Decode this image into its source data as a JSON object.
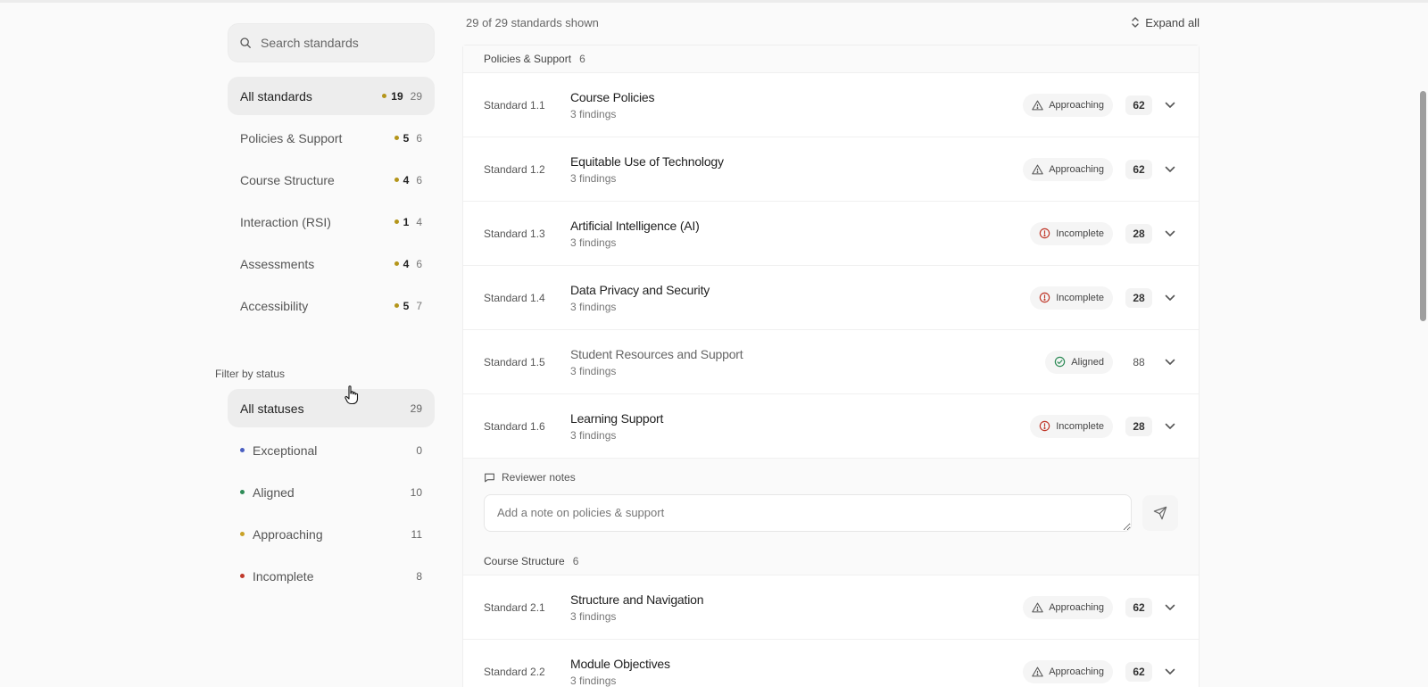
{
  "search": {
    "placeholder": "Search standards"
  },
  "categories": [
    {
      "label": "All standards",
      "count_a": "19",
      "count_b": "29",
      "active": true
    },
    {
      "label": "Policies & Support",
      "count_a": "5",
      "count_b": "6"
    },
    {
      "label": "Course Structure",
      "count_a": "4",
      "count_b": "6"
    },
    {
      "label": "Interaction (RSI)",
      "count_a": "1",
      "count_b": "4"
    },
    {
      "label": "Assessments",
      "count_a": "4",
      "count_b": "6"
    },
    {
      "label": "Accessibility",
      "count_a": "5",
      "count_b": "7"
    }
  ],
  "filter": {
    "title": "Filter by status",
    "statuses": [
      {
        "label": "All statuses",
        "count": "29",
        "active": true
      },
      {
        "label": "Exceptional",
        "count": "0",
        "color": "#4a5fc1"
      },
      {
        "label": "Aligned",
        "count": "10",
        "color": "#2e8b57"
      },
      {
        "label": "Approaching",
        "count": "11",
        "color": "#c9a227"
      },
      {
        "label": "Incomplete",
        "count": "8",
        "color": "#c0392b"
      }
    ]
  },
  "main": {
    "shown_text": "29 of 29 standards shown",
    "expand_label": "Expand all",
    "groups": [
      {
        "name": "Policies & Support",
        "count": "6",
        "rows": [
          {
            "code": "Standard 1.1",
            "title": "Course Policies",
            "findings": "3 findings",
            "status": "Approaching",
            "score": "62"
          },
          {
            "code": "Standard 1.2",
            "title": "Equitable Use of Technology",
            "findings": "3 findings",
            "status": "Approaching",
            "score": "62"
          },
          {
            "code": "Standard 1.3",
            "title": "Artificial Intelligence (AI)",
            "findings": "3 findings",
            "status": "Incomplete",
            "score": "28"
          },
          {
            "code": "Standard 1.4",
            "title": "Data Privacy and Security",
            "findings": "3 findings",
            "status": "Incomplete",
            "score": "28"
          },
          {
            "code": "Standard 1.5",
            "title": "Student Resources and Support",
            "findings": "3 findings",
            "status": "Aligned",
            "score": "88"
          },
          {
            "code": "Standard 1.6",
            "title": "Learning Support",
            "findings": "3 findings",
            "status": "Incomplete",
            "score": "28"
          }
        ],
        "notes": {
          "label": "Reviewer notes",
          "placeholder": "Add a note on policies & support"
        }
      },
      {
        "name": "Course Structure",
        "count": "6",
        "rows": [
          {
            "code": "Standard 2.1",
            "title": "Structure and Navigation",
            "findings": "3 findings",
            "status": "Approaching",
            "score": "62"
          },
          {
            "code": "Standard 2.2",
            "title": "Module Objectives",
            "findings": "3 findings",
            "status": "Approaching",
            "score": "62"
          }
        ]
      }
    ]
  },
  "icons": {
    "search": "search-icon",
    "expand": "expand-vertical-icon",
    "approaching": "warning-triangle-icon",
    "incomplete": "alert-circle-icon",
    "aligned": "check-circle-icon",
    "chevron": "chevron-down-icon",
    "notes": "message-square-icon",
    "send": "send-icon",
    "cursor": "hand-pointer-icon"
  }
}
